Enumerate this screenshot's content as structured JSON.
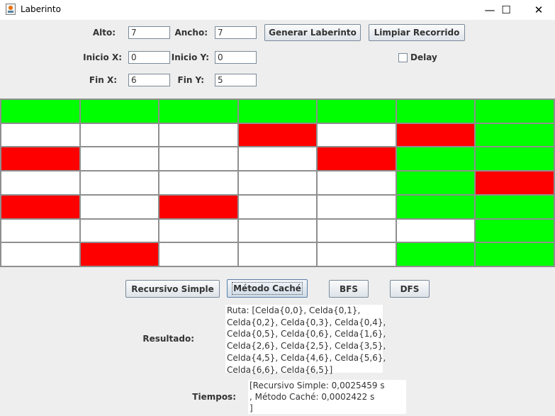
{
  "window": {
    "title": "Laberinto",
    "minimize_glyph": "—",
    "maximize_glyph": "☐",
    "close_glyph": "✕"
  },
  "controls": {
    "alto_label": "Alto:",
    "alto_value": "7",
    "ancho_label": "Ancho:",
    "ancho_value": "7",
    "generar_label": "Generar Laberinto",
    "limpiar_label": "Limpiar Recorrido",
    "inicio_x_label": "Inicio X:",
    "inicio_x_value": "0",
    "inicio_y_label": "Inicio Y:",
    "inicio_y_value": "0",
    "delay_label": "Delay",
    "delay_checked": false,
    "fin_x_label": "Fin X:",
    "fin_x_value": "6",
    "fin_y_label": "Fin Y:",
    "fin_y_value": "5"
  },
  "maze": {
    "rows": 7,
    "cols": 7,
    "colors": {
      "path": "#00ff00",
      "wall": "#ff0000",
      "free": "#ffffff"
    },
    "cells": [
      [
        "path",
        "path",
        "path",
        "path",
        "path",
        "path",
        "path"
      ],
      [
        "free",
        "free",
        "free",
        "wall",
        "free",
        "wall",
        "path"
      ],
      [
        "wall",
        "free",
        "free",
        "free",
        "wall",
        "path",
        "path"
      ],
      [
        "free",
        "free",
        "free",
        "free",
        "free",
        "path",
        "wall"
      ],
      [
        "wall",
        "free",
        "wall",
        "free",
        "free",
        "path",
        "path"
      ],
      [
        "free",
        "free",
        "free",
        "free",
        "free",
        "free",
        "path"
      ],
      [
        "free",
        "wall",
        "free",
        "free",
        "free",
        "path",
        "path"
      ]
    ]
  },
  "algorithms": {
    "recursivo_label": "Recursivo Simple",
    "cache_label": "Método Caché",
    "bfs_label": "BFS",
    "dfs_label": "DFS"
  },
  "results": {
    "resultado_label": "Resultado:",
    "resultado_text": "Ruta: [Celda{0,0}, Celda{0,1},\nCelda{0,2}, Celda{0,3}, Celda{0,4},\nCelda{0,5}, Celda{0,6}, Celda{1,6},\nCelda{2,6}, Celda{2,5}, Celda{3,5},\nCelda{4,5}, Celda{4,6}, Celda{5,6},\nCelda{6,6}, Celda{6,5}]",
    "tiempos_label": "Tiempos:",
    "tiempos_text": "[Recursivo Simple: 0,0025459 s\n, Método Caché: 0,0002422 s\n]"
  }
}
